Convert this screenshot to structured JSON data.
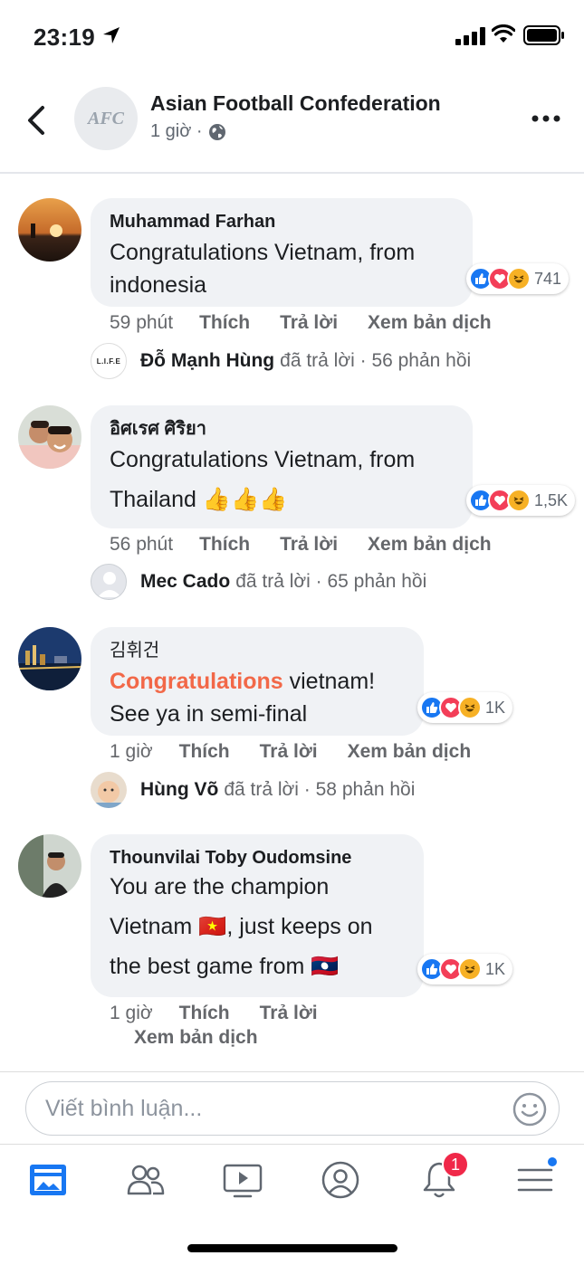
{
  "status_bar": {
    "time": "23:19"
  },
  "header": {
    "page_name": "Asian Football Confederation",
    "avatar_text": "AFC",
    "post_time": "1 giờ ·"
  },
  "comments": [
    {
      "author": "Muhammad Farhan",
      "text": "Congratulations Vietnam, from indonesia",
      "reactions": "741",
      "time": "59 phút",
      "like": "Thích",
      "reply": "Trả lời",
      "translate": "Xem bản dịch",
      "reply_author": "Đỗ Mạnh Hùng",
      "reply_avatar_text": "L.I.F.E",
      "reply_text": "đã trả lời · 56 phản hồi"
    },
    {
      "author": "อิศเรศ ศิริยา",
      "text": "Congratulations Vietnam, from Thailand 👍👍👍",
      "reactions": "1,5K",
      "time": "56 phút",
      "like": "Thích",
      "reply": "Trả lời",
      "translate": "Xem bản dịch",
      "reply_author": "Mec Cado",
      "reply_text": "đã trả lời · 65 phản hồi"
    },
    {
      "author": "김휘건",
      "text_highlight": "Congratulations",
      "text": " vietnam! See ya in semi-final",
      "reactions": "1K",
      "time": "1 giờ",
      "like": "Thích",
      "reply": "Trả lời",
      "translate": "Xem bản dịch",
      "reply_author": "Hùng Võ",
      "reply_text": "đã trả lời · 58 phản hồi"
    },
    {
      "author": "Thounvilai Toby Oudomsine",
      "text_line1": "You are the champion",
      "text_line2": "Vietnam 🇻🇳, just keeps on",
      "text_line3": "the best game from 🇱🇦",
      "reactions": "1K",
      "time": "1 giờ",
      "like": "Thích",
      "reply": "Trả lời",
      "translate": "Xem bản dịch"
    }
  ],
  "compose": {
    "placeholder": "Viết bình luận..."
  },
  "tabbar": {
    "notification_count": "1"
  },
  "colors": {
    "facebook_blue": "#1877f2",
    "bubble_bg": "#f0f2f5",
    "highlight": "#f26848",
    "badge": "#f02849"
  }
}
